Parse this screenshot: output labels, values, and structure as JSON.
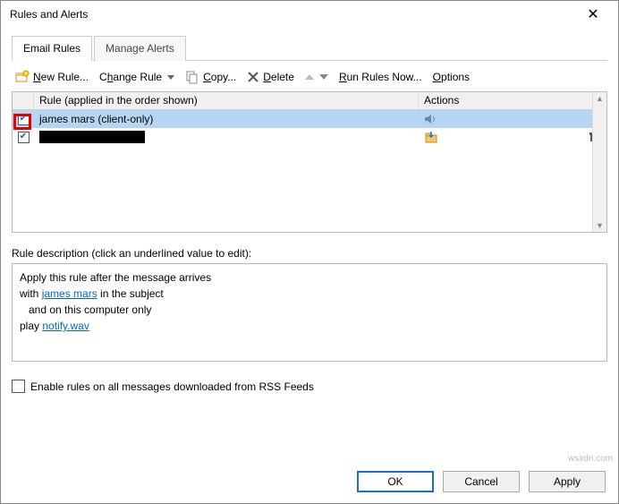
{
  "window": {
    "title": "Rules and Alerts"
  },
  "tabs": {
    "email_rules": "Email Rules",
    "manage_alerts": "Manage Alerts"
  },
  "toolbar": {
    "new_rule": "New Rule...",
    "change_rule": "Change Rule",
    "copy": "Copy...",
    "delete": "Delete",
    "run_rules_now": "Run Rules Now...",
    "options": "Options"
  },
  "rules_list": {
    "header_rule": "Rule (applied in the order shown)",
    "header_actions": "Actions",
    "rows": [
      {
        "checked": true,
        "name": "james mars  (client-only)",
        "selected": true,
        "highlighted_check": true,
        "action_icon": "sound"
      },
      {
        "checked": true,
        "name": "",
        "redacted": true,
        "action_icon": "move-folder",
        "extra_icon": "tools"
      }
    ]
  },
  "description": {
    "label": "Rule description (click an underlined value to edit):",
    "line1": "Apply this rule after the message arrives",
    "line2_prefix": "with ",
    "line2_link": "james mars",
    "line2_suffix": " in the subject",
    "line3": "and on this computer only",
    "line4_prefix": "play ",
    "line4_link": "notify.wav"
  },
  "rss_checkbox": {
    "label": "Enable rules on all messages downloaded from RSS Feeds",
    "checked": false
  },
  "buttons": {
    "ok": "OK",
    "cancel": "Cancel",
    "apply": "Apply"
  },
  "watermark": "wsxdn.com"
}
